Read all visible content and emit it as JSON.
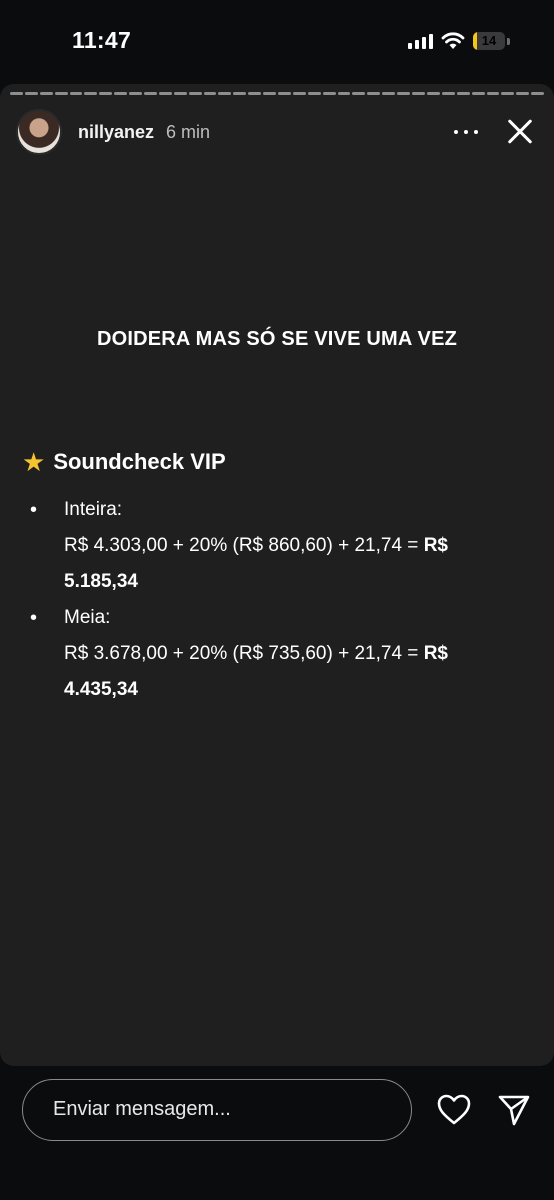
{
  "status_bar": {
    "time": "11:47",
    "battery": "14",
    "battery_level": 0.14
  },
  "story": {
    "username": "nillyanez",
    "time_ago": "6 min",
    "headline": "DOIDERA MAS SÓ SE VIVE UMA VEZ",
    "section_icon": "star-icon",
    "section_title": "Soundcheck VIP",
    "items": [
      {
        "label": "Inteira:",
        "formula": "R$ 4.303,00 + 20% (R$ 860,60) + 21,74 = ",
        "total_a": "R$",
        "total_b": "5.185,34"
      },
      {
        "label": "Meia:",
        "formula": "R$ 3.678,00 + 20% (R$ 735,60) + 21,74 = ",
        "total_a": "R$",
        "total_b": "4.435,34"
      }
    ]
  },
  "composer": {
    "placeholder": "Enviar mensagem..."
  },
  "icons": [
    "signal-icon",
    "wifi-icon",
    "battery-icon",
    "more-icon",
    "close-icon",
    "star-icon",
    "heart-icon",
    "send-icon"
  ]
}
